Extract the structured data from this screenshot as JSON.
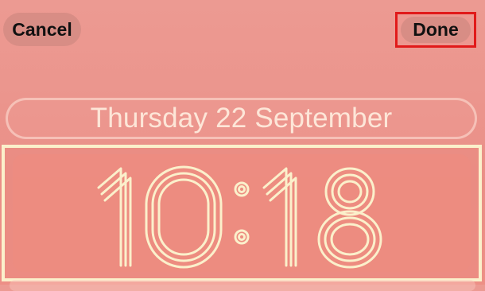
{
  "topbar": {
    "cancel_label": "Cancel",
    "done_label": "Done"
  },
  "lockscreen": {
    "date": "Thursday 22 September",
    "time": "10:18",
    "time_digits": [
      "1",
      "0",
      ":",
      "1",
      "8"
    ]
  },
  "colors": {
    "background": "#ec968e",
    "clock_outline": "#fbf0cb",
    "date_text": "#fde6d8",
    "done_highlight": "#e11a1a",
    "button_text": "#111111"
  }
}
